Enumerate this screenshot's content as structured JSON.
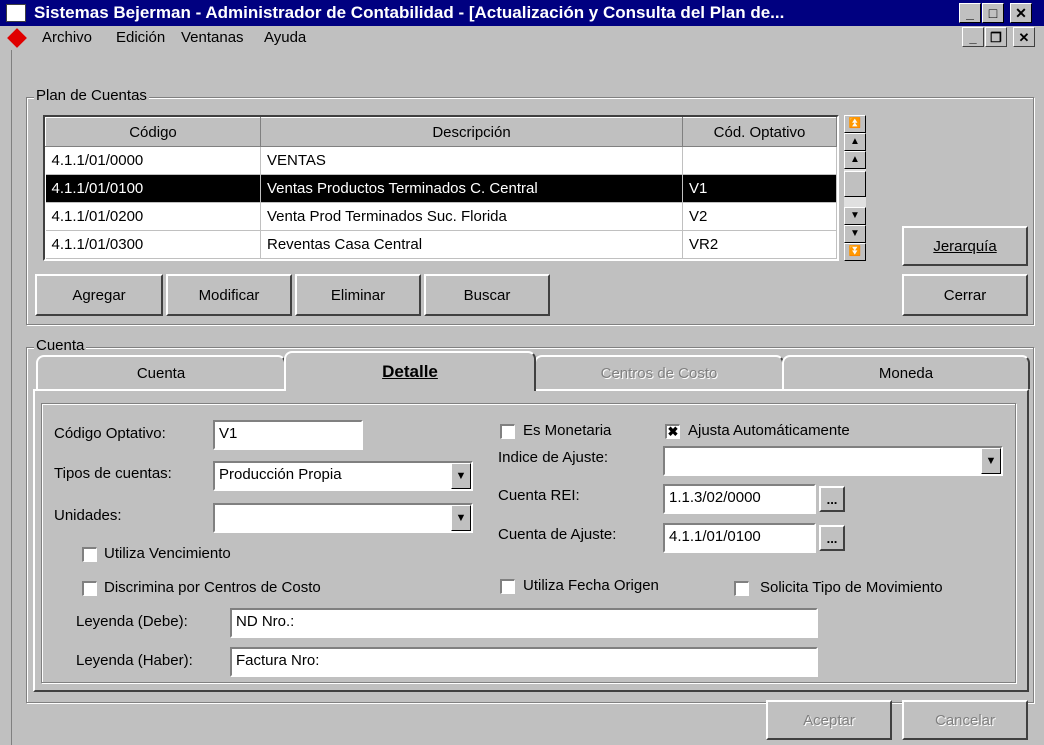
{
  "window": {
    "title": "Sistemas Bejerman - Administrador de Contabilidad - [Actualización y Consulta del Plan de...",
    "minimize": "_",
    "maximize": "□",
    "close": "✕"
  },
  "menu": {
    "items": [
      {
        "label": "Archivo"
      },
      {
        "label": "Edición"
      },
      {
        "label": "Ventanas"
      },
      {
        "label": "Ayuda"
      }
    ],
    "mdi_minimize": "_",
    "mdi_restore": "❐",
    "mdi_close": "✕"
  },
  "plan": {
    "group_label": "Plan de Cuentas",
    "columns": [
      "Código",
      "Descripción",
      "Cód. Optativo"
    ],
    "rows": [
      {
        "codigo": "4.1.1/01/0000",
        "descripcion": "VENTAS",
        "optativo": ""
      },
      {
        "codigo": "4.1.1/01/0100",
        "descripcion": "Ventas Productos Terminados  C. Central",
        "optativo": "V1",
        "selected": true
      },
      {
        "codigo": "4.1.1/01/0200",
        "descripcion": "Venta Prod Terminados Suc. Florida",
        "optativo": "V2"
      },
      {
        "codigo": "4.1.1/01/0300",
        "descripcion": "Reventas Casa Central",
        "optativo": "VR2"
      }
    ],
    "jerarquia_button": "Jerarquía",
    "buttons": {
      "agregar": "Agregar",
      "modificar": "Modificar",
      "eliminar": "Eliminar",
      "buscar": "Buscar",
      "cerrar": "Cerrar"
    }
  },
  "cuenta": {
    "group_label": "Cuenta",
    "tabs": [
      {
        "label": "Cuenta",
        "state": "normal"
      },
      {
        "label": "Detalle",
        "state": "active"
      },
      {
        "label": "Centros de Costo",
        "state": "disabled"
      },
      {
        "label": "Moneda",
        "state": "normal"
      }
    ],
    "detalle": {
      "codigo_optativo_label": "Código Optativo:",
      "codigo_optativo_value": "V1",
      "tipos_label": "Tipos de cuentas:",
      "tipos_value": "Producción Propia",
      "unidades_label": "Unidades:",
      "unidades_value": "",
      "utiliza_vencimiento": {
        "label": "Utiliza Vencimiento",
        "checked": false
      },
      "discrimina_centros": {
        "label": "Discrimina por Centros de Costo",
        "checked": false
      },
      "es_monetaria": {
        "label": "Es Monetaria",
        "checked": false
      },
      "ajusta_auto": {
        "label": "Ajusta Automáticamente",
        "checked": true,
        "mark": "✖"
      },
      "indice_label": "Indice de Ajuste:",
      "indice_value": "",
      "cuenta_rei_label": "Cuenta REI:",
      "cuenta_rei_value": "1.1.3/02/0000",
      "cuenta_ajuste_label": "Cuenta de Ajuste:",
      "cuenta_ajuste_value": "4.1.1/01/0100",
      "utiliza_fecha_origen": {
        "label": "Utiliza Fecha Origen",
        "checked": false
      },
      "solicita_tipo_mov": {
        "label": "Solicita Tipo de Movimiento",
        "checked": false
      },
      "leyenda_debe_label": "Leyenda (Debe):",
      "leyenda_debe_value": "ND Nro.:",
      "leyenda_haber_label": "Leyenda (Haber):",
      "leyenda_haber_value": "Factura Nro:",
      "ellipsis": "..."
    }
  },
  "footer": {
    "aceptar": "Aceptar",
    "cancelar": "Cancelar"
  },
  "colors": {
    "titlebar": "#000080",
    "face": "#c0c0c0",
    "selection": "#000000",
    "diamond": "#e00000"
  }
}
